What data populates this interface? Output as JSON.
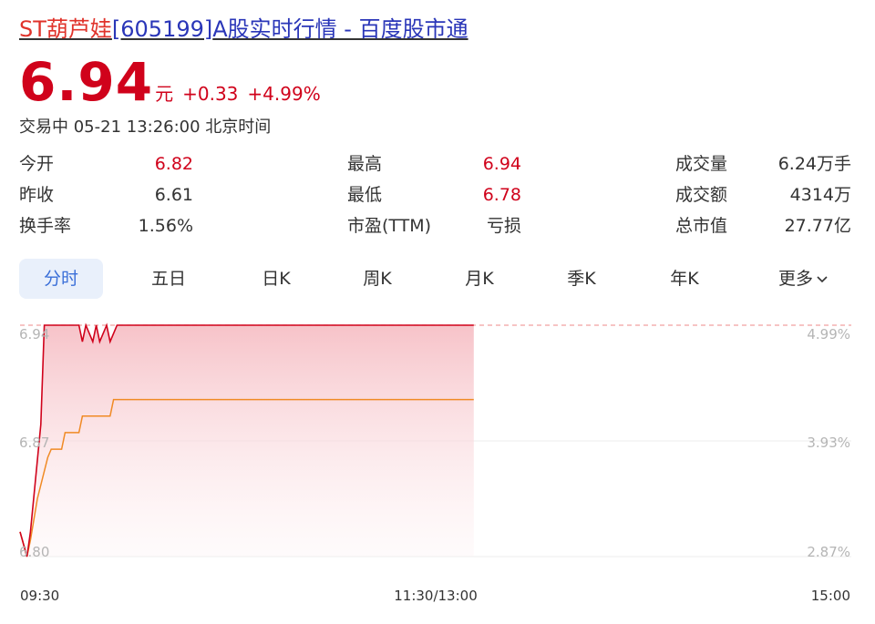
{
  "header": {
    "title_name": "ST葫芦娃",
    "title_code": "[605199]",
    "title_rest": "A股实时行情 - 百度股市通"
  },
  "quote": {
    "price": "6.94",
    "unit": "元",
    "change": "+0.33",
    "change_pct": "+4.99%",
    "status": "交易中 05-21 13:26:00 北京时间"
  },
  "stats": [
    {
      "label": "今开",
      "value": "6.82",
      "color": "red"
    },
    {
      "label": "最高",
      "value": "6.94",
      "color": "red"
    },
    {
      "label": "成交量",
      "value": "6.24万手",
      "color": "dark"
    },
    {
      "label": "昨收",
      "value": "6.61",
      "color": "dark"
    },
    {
      "label": "最低",
      "value": "6.78",
      "color": "red"
    },
    {
      "label": "成交额",
      "value": "4314万",
      "color": "dark"
    },
    {
      "label": "换手率",
      "value": "1.56%",
      "color": "dark"
    },
    {
      "label": "市盈(TTM)",
      "value": "亏损",
      "color": "dark"
    },
    {
      "label": "总市值",
      "value": "27.77亿",
      "color": "dark"
    }
  ],
  "tabs": [
    {
      "label": "分时",
      "active": true
    },
    {
      "label": "五日"
    },
    {
      "label": "日K"
    },
    {
      "label": "周K"
    },
    {
      "label": "月K"
    },
    {
      "label": "季K"
    },
    {
      "label": "年K"
    },
    {
      "label": "更多"
    }
  ],
  "colors": {
    "price_line": "#d0021b",
    "avg_line": "#f08a24",
    "limit_line": "#f2a0a0",
    "grid": "#eeeeee",
    "axis_text": "#b5b5b5"
  },
  "chart_data": {
    "type": "line",
    "title": "",
    "xlabel": "",
    "ylabel": "",
    "ylim": [
      6.8,
      6.94
    ],
    "y_ticks": [
      "6.94",
      "6.87",
      "6.80"
    ],
    "y_ticks_right": [
      "4.99%",
      "3.93%",
      "2.87%"
    ],
    "x_ticks": [
      "09:30",
      "11:30/13:00",
      "15:00"
    ],
    "session_minutes": 240,
    "series": [
      {
        "key": "price",
        "x": [
          0,
          2,
          3,
          6,
          7,
          8,
          9,
          12,
          17,
          18,
          19,
          21,
          22,
          23,
          25,
          26,
          28,
          131
        ],
        "y": [
          6.815,
          6.8,
          6.815,
          6.88,
          6.94,
          6.94,
          6.94,
          6.94,
          6.94,
          6.93,
          6.94,
          6.93,
          6.94,
          6.93,
          6.94,
          6.93,
          6.94,
          6.94
        ]
      },
      {
        "key": "avg",
        "x": [
          0,
          2,
          3,
          5,
          8,
          9,
          12,
          13,
          17,
          18,
          19,
          26,
          27,
          131
        ],
        "y": [
          6.815,
          6.8,
          6.81,
          6.835,
          6.86,
          6.865,
          6.865,
          6.875,
          6.875,
          6.885,
          6.885,
          6.885,
          6.895,
          6.895
        ]
      }
    ]
  }
}
